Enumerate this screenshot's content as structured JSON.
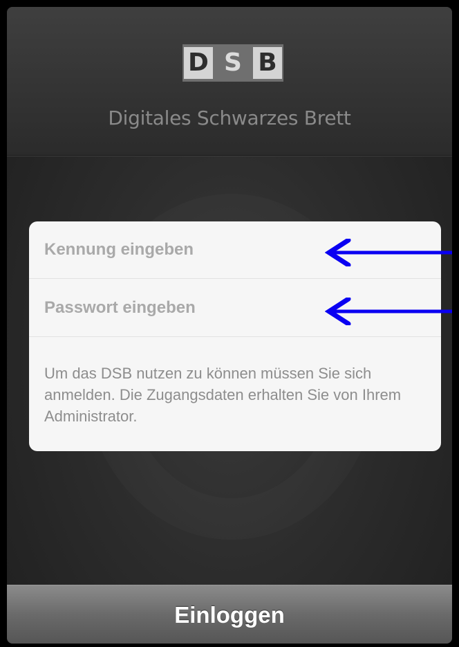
{
  "header": {
    "logo_letters": [
      "D",
      "S",
      "B"
    ],
    "app_title": "Digitales Schwarzes Brett"
  },
  "login_form": {
    "username": {
      "value": "",
      "placeholder": "Kennung eingeben"
    },
    "password": {
      "value": "",
      "placeholder": "Passwort eingeben"
    },
    "info_text": "Um das DSB nutzen zu können müssen Sie sich anmelden. Die Zugangsdaten erhalten Sie von Ihrem Administrator."
  },
  "footer": {
    "login_label": "Einloggen"
  },
  "annotations": {
    "arrow_color": "#0a00f2",
    "icons": [
      "left-arrow-icon",
      "left-arrow-icon"
    ]
  },
  "colors": {
    "background": "#2c2c2c",
    "card": "#f6f6f6",
    "login_bar": "#6a6a6a"
  }
}
